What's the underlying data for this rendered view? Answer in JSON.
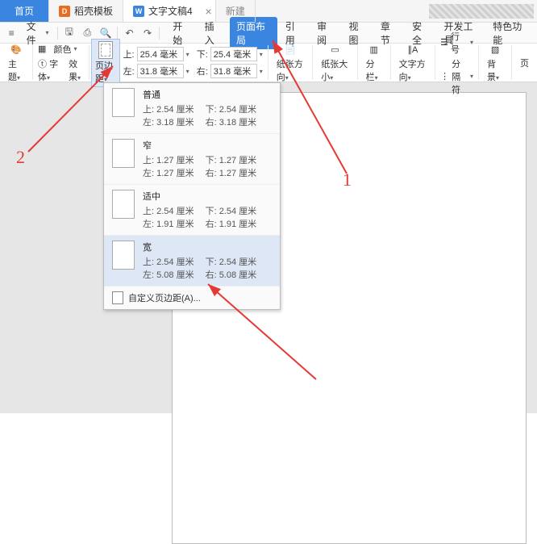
{
  "tabs": {
    "home": "首页",
    "docke": "稻壳模板",
    "doc": "文字文稿4",
    "newtab": "新建"
  },
  "quickbar": {
    "file": "文件",
    "menu": [
      "开始",
      "插入",
      "页面布局",
      "引用",
      "审阅",
      "视图",
      "章节",
      "安全",
      "开发工具",
      "特色功能"
    ]
  },
  "ribbon": {
    "theme": "主题",
    "color": "颜色",
    "font": "字体",
    "effect": "效果",
    "margin_btn": "页边距",
    "top_lbl": "上:",
    "bottom_lbl": "下:",
    "left_lbl": "左:",
    "right_lbl": "右:",
    "top_val": "25.4 毫米",
    "bottom_val": "25.4 毫米",
    "left_val": "31.8 毫米",
    "right_val": "31.8 毫米",
    "orientation": "纸张方向",
    "size": "纸张大小",
    "columns": "分栏",
    "textdir": "文字方向",
    "lineno": "行号",
    "breaks": "分隔符",
    "bg": "背景",
    "pg": "页"
  },
  "dropdown": {
    "opts": [
      {
        "title": "普通",
        "t": "上: 2.54 厘米",
        "b": "下: 2.54 厘米",
        "l": "左: 3.18 厘米",
        "r": "右: 3.18 厘米"
      },
      {
        "title": "窄",
        "t": "上: 1.27 厘米",
        "b": "下: 1.27 厘米",
        "l": "左: 1.27 厘米",
        "r": "右: 1.27 厘米"
      },
      {
        "title": "适中",
        "t": "上: 2.54 厘米",
        "b": "下: 2.54 厘米",
        "l": "左: 1.91 厘米",
        "r": "右: 1.91 厘米"
      },
      {
        "title": "宽",
        "t": "上: 2.54 厘米",
        "b": "下: 2.54 厘米",
        "l": "左: 5.08 厘米",
        "r": "右: 5.08 厘米"
      }
    ],
    "custom": "自定义页边距(A)..."
  },
  "annot": {
    "n1": "1",
    "n2": "2"
  }
}
